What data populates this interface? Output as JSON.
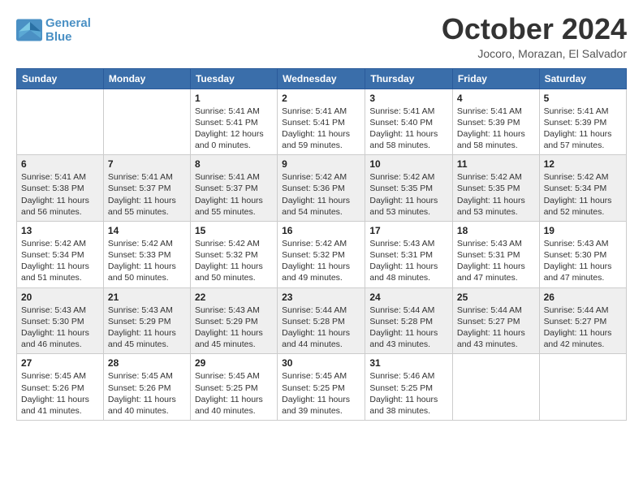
{
  "header": {
    "logo_line1": "General",
    "logo_line2": "Blue",
    "month_title": "October 2024",
    "subtitle": "Jocoro, Morazan, El Salvador"
  },
  "weekdays": [
    "Sunday",
    "Monday",
    "Tuesday",
    "Wednesday",
    "Thursday",
    "Friday",
    "Saturday"
  ],
  "weeks": [
    [
      {
        "day": "",
        "info": ""
      },
      {
        "day": "",
        "info": ""
      },
      {
        "day": "1",
        "info": "Sunrise: 5:41 AM\nSunset: 5:41 PM\nDaylight: 12 hours and 0 minutes."
      },
      {
        "day": "2",
        "info": "Sunrise: 5:41 AM\nSunset: 5:41 PM\nDaylight: 11 hours and 59 minutes."
      },
      {
        "day": "3",
        "info": "Sunrise: 5:41 AM\nSunset: 5:40 PM\nDaylight: 11 hours and 58 minutes."
      },
      {
        "day": "4",
        "info": "Sunrise: 5:41 AM\nSunset: 5:39 PM\nDaylight: 11 hours and 58 minutes."
      },
      {
        "day": "5",
        "info": "Sunrise: 5:41 AM\nSunset: 5:39 PM\nDaylight: 11 hours and 57 minutes."
      }
    ],
    [
      {
        "day": "6",
        "info": "Sunrise: 5:41 AM\nSunset: 5:38 PM\nDaylight: 11 hours and 56 minutes."
      },
      {
        "day": "7",
        "info": "Sunrise: 5:41 AM\nSunset: 5:37 PM\nDaylight: 11 hours and 55 minutes."
      },
      {
        "day": "8",
        "info": "Sunrise: 5:41 AM\nSunset: 5:37 PM\nDaylight: 11 hours and 55 minutes."
      },
      {
        "day": "9",
        "info": "Sunrise: 5:42 AM\nSunset: 5:36 PM\nDaylight: 11 hours and 54 minutes."
      },
      {
        "day": "10",
        "info": "Sunrise: 5:42 AM\nSunset: 5:35 PM\nDaylight: 11 hours and 53 minutes."
      },
      {
        "day": "11",
        "info": "Sunrise: 5:42 AM\nSunset: 5:35 PM\nDaylight: 11 hours and 53 minutes."
      },
      {
        "day": "12",
        "info": "Sunrise: 5:42 AM\nSunset: 5:34 PM\nDaylight: 11 hours and 52 minutes."
      }
    ],
    [
      {
        "day": "13",
        "info": "Sunrise: 5:42 AM\nSunset: 5:34 PM\nDaylight: 11 hours and 51 minutes."
      },
      {
        "day": "14",
        "info": "Sunrise: 5:42 AM\nSunset: 5:33 PM\nDaylight: 11 hours and 50 minutes."
      },
      {
        "day": "15",
        "info": "Sunrise: 5:42 AM\nSunset: 5:32 PM\nDaylight: 11 hours and 50 minutes."
      },
      {
        "day": "16",
        "info": "Sunrise: 5:42 AM\nSunset: 5:32 PM\nDaylight: 11 hours and 49 minutes."
      },
      {
        "day": "17",
        "info": "Sunrise: 5:43 AM\nSunset: 5:31 PM\nDaylight: 11 hours and 48 minutes."
      },
      {
        "day": "18",
        "info": "Sunrise: 5:43 AM\nSunset: 5:31 PM\nDaylight: 11 hours and 47 minutes."
      },
      {
        "day": "19",
        "info": "Sunrise: 5:43 AM\nSunset: 5:30 PM\nDaylight: 11 hours and 47 minutes."
      }
    ],
    [
      {
        "day": "20",
        "info": "Sunrise: 5:43 AM\nSunset: 5:30 PM\nDaylight: 11 hours and 46 minutes."
      },
      {
        "day": "21",
        "info": "Sunrise: 5:43 AM\nSunset: 5:29 PM\nDaylight: 11 hours and 45 minutes."
      },
      {
        "day": "22",
        "info": "Sunrise: 5:43 AM\nSunset: 5:29 PM\nDaylight: 11 hours and 45 minutes."
      },
      {
        "day": "23",
        "info": "Sunrise: 5:44 AM\nSunset: 5:28 PM\nDaylight: 11 hours and 44 minutes."
      },
      {
        "day": "24",
        "info": "Sunrise: 5:44 AM\nSunset: 5:28 PM\nDaylight: 11 hours and 43 minutes."
      },
      {
        "day": "25",
        "info": "Sunrise: 5:44 AM\nSunset: 5:27 PM\nDaylight: 11 hours and 43 minutes."
      },
      {
        "day": "26",
        "info": "Sunrise: 5:44 AM\nSunset: 5:27 PM\nDaylight: 11 hours and 42 minutes."
      }
    ],
    [
      {
        "day": "27",
        "info": "Sunrise: 5:45 AM\nSunset: 5:26 PM\nDaylight: 11 hours and 41 minutes."
      },
      {
        "day": "28",
        "info": "Sunrise: 5:45 AM\nSunset: 5:26 PM\nDaylight: 11 hours and 40 minutes."
      },
      {
        "day": "29",
        "info": "Sunrise: 5:45 AM\nSunset: 5:25 PM\nDaylight: 11 hours and 40 minutes."
      },
      {
        "day": "30",
        "info": "Sunrise: 5:45 AM\nSunset: 5:25 PM\nDaylight: 11 hours and 39 minutes."
      },
      {
        "day": "31",
        "info": "Sunrise: 5:46 AM\nSunset: 5:25 PM\nDaylight: 11 hours and 38 minutes."
      },
      {
        "day": "",
        "info": ""
      },
      {
        "day": "",
        "info": ""
      }
    ]
  ]
}
